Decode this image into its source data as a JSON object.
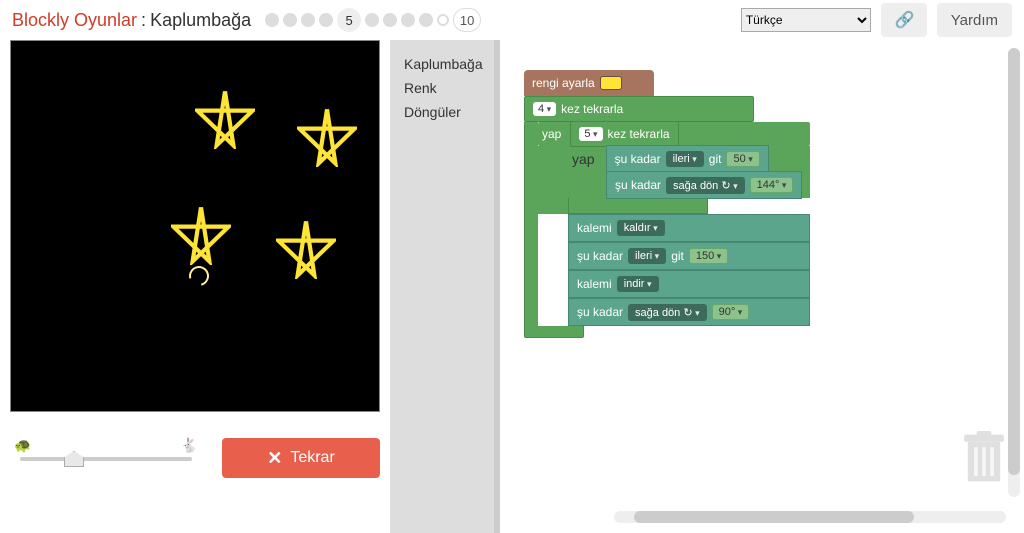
{
  "header": {
    "app_title": "Blockly Oyunlar",
    "separator": ":",
    "game_title": "Kaplumbağa",
    "levels": {
      "current": "5",
      "total": "10"
    },
    "language_selected": "Türkçe",
    "help_label": "Yardım"
  },
  "toolbox": {
    "items": [
      "Kaplumbağa",
      "Renk",
      "Döngüler"
    ]
  },
  "controls": {
    "run_label": "Tekrar"
  },
  "colors": {
    "accent_red": "#e8604c",
    "star_yellow": "#ffe438",
    "loop_green": "#5ba55b",
    "move_teal": "#5ba58c",
    "color_brown": "#a6745f"
  },
  "blocks": {
    "set_color_label": "rengi ayarla",
    "outer_repeat_n": "4",
    "repeat_suffix": "kez tekrarla",
    "do_label": "yap",
    "inner_repeat_n": "5",
    "move_prefix": "şu kadar",
    "forward_label": "ileri",
    "go_label": "git",
    "forward_value": "50",
    "turn_right_label": "sağa dön ↻",
    "turn_angle_inner": "144°",
    "pen_label": "kalemi",
    "pen_up": "kaldır",
    "forward_value2": "150",
    "pen_down": "indir",
    "turn_angle_outer": "90°"
  }
}
